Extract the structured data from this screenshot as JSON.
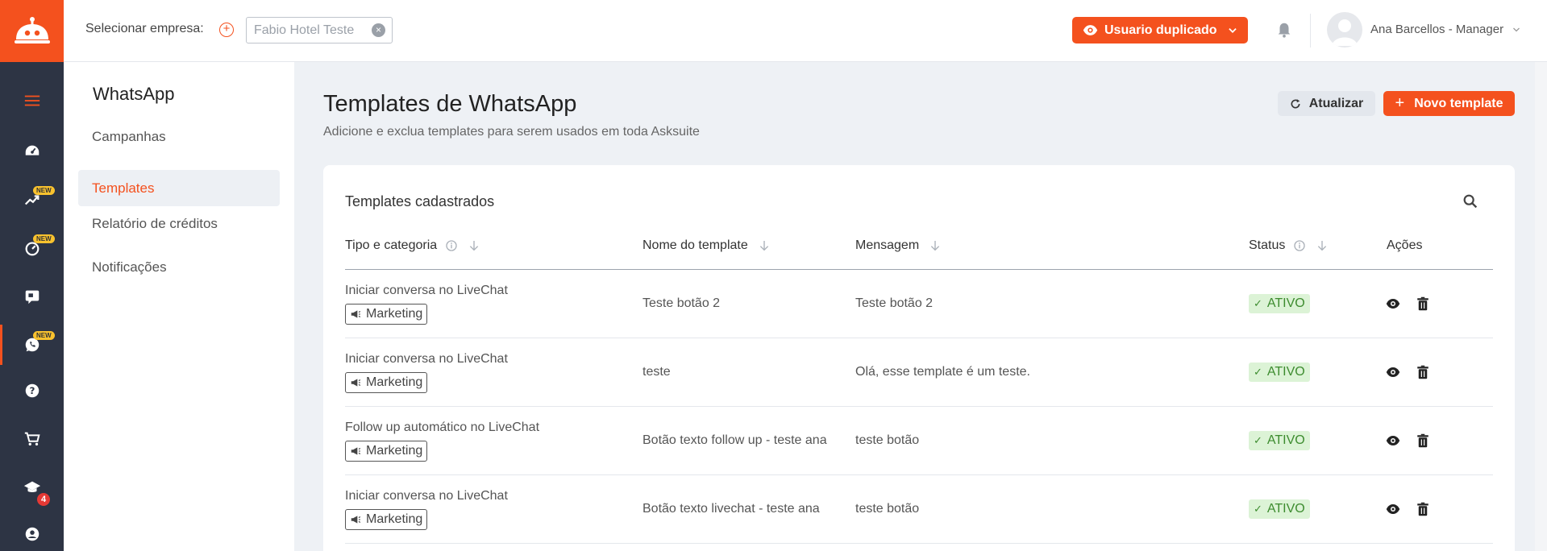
{
  "header": {
    "company_label": "Selecionar empresa:",
    "company_value": "Fabio Hotel Teste",
    "duplicate_label": "Usuario duplicado",
    "user_name": "Ana Barcellos - Manager"
  },
  "rail": {
    "new_badge": "NEW",
    "notifications_count": "4",
    "items": [
      "menu-icon",
      "dashboard-icon",
      "analytics-icon",
      "speedometer-icon",
      "chat-icon",
      "whatsapp-icon",
      "help-icon",
      "cart-icon",
      "graduation-cap-icon",
      "user-icon"
    ]
  },
  "subnav": {
    "title": "WhatsApp",
    "items": [
      "Campanhas",
      "Templates",
      "Relatório de créditos",
      "Notificações"
    ],
    "active": "Templates"
  },
  "page": {
    "title": "Templates de WhatsApp",
    "subtitle": "Adicione e exclua templates para serem usados em toda Asksuite",
    "refresh_label": "Atualizar",
    "new_label": "Novo template"
  },
  "table": {
    "title": "Templates cadastrados",
    "headers": {
      "category": "Tipo e categoria",
      "name": "Nome do template",
      "message": "Mensagem",
      "status": "Status",
      "actions": "Ações"
    },
    "rows": [
      {
        "type": "Iniciar conversa no LiveChat",
        "category": "Marketing",
        "name": "Teste botão 2",
        "message": "Teste botão 2",
        "status": "ATIVO"
      },
      {
        "type": "Iniciar conversa no LiveChat",
        "category": "Marketing",
        "name": "teste",
        "message": "Olá, esse template é um teste.",
        "status": "ATIVO"
      },
      {
        "type": "Follow up automático no LiveChat",
        "category": "Marketing",
        "name": "Botão texto follow up - teste ana",
        "message": "teste botão",
        "status": "ATIVO"
      },
      {
        "type": "Iniciar conversa no LiveChat",
        "category": "Marketing",
        "name": "Botão texto livechat - teste ana",
        "message": "teste botão",
        "status": "ATIVO"
      }
    ]
  },
  "colors": {
    "accent": "#f4511e",
    "rail": "#2d3444",
    "status_bg": "#dcf3d6",
    "status_text": "#3d8c2f"
  }
}
